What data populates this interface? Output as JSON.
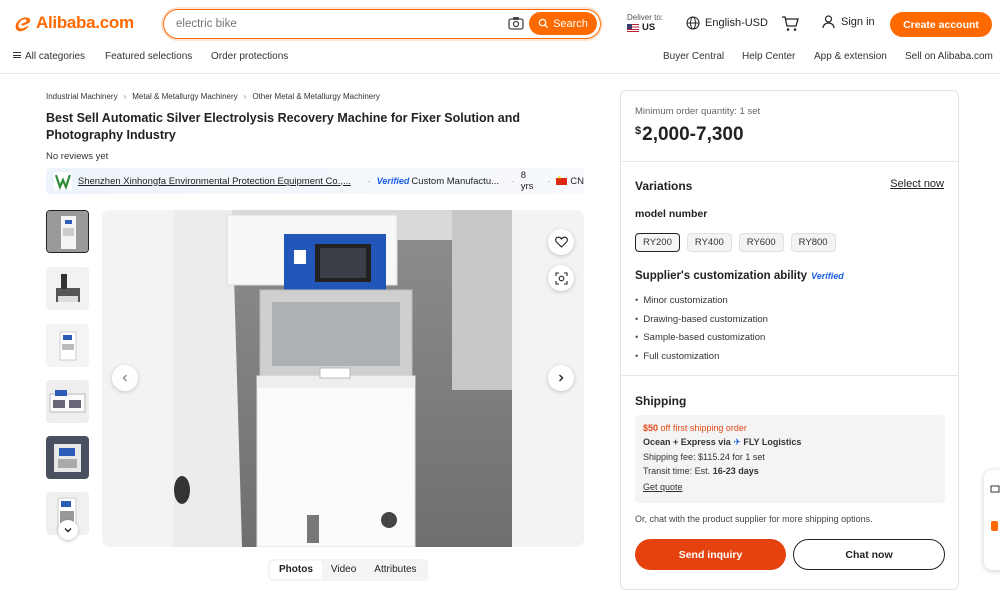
{
  "header": {
    "logo_text": "Alibaba.com",
    "search_placeholder": "electric bike",
    "search_button": "Search",
    "deliver_label": "Deliver to:",
    "deliver_country": "US",
    "language": "English-USD",
    "signin": "Sign in",
    "create_account": "Create account",
    "brand_color": "#ff6a00"
  },
  "nav": {
    "all_categories": "All categories",
    "featured": "Featured selections",
    "order_protections": "Order protections",
    "buyer_central": "Buyer Central",
    "help_center": "Help Center",
    "app_extension": "App & extension",
    "sell": "Sell on Alibaba.com"
  },
  "breadcrumb": [
    "Industrial Machinery",
    "Metal & Metallurgy Machinery",
    "Other Metal & Metallurgy Machinery"
  ],
  "product": {
    "title": "Best Sell Automatic Silver Electrolysis Recovery Machine for Fixer Solution and Photography Industry",
    "reviews": "No reviews yet"
  },
  "supplier": {
    "name": "Shenzhen Xinhongfa Environmental Protection Equipment Co.,...",
    "verified": "Verified",
    "type": "Custom Manufactu...",
    "years": "8 yrs",
    "country": "CN"
  },
  "media_tabs": [
    "Photos",
    "Video",
    "Attributes"
  ],
  "purchase": {
    "moq": "Minimum order quantity: 1 set",
    "price_symbol": "$",
    "price": "2,000-7,300",
    "variations_title": "Variations",
    "select_now": "Select now",
    "model_label": "model number",
    "models": [
      "RY200",
      "RY400",
      "RY600",
      "RY800"
    ],
    "customization_title": "Supplier's customization ability",
    "customization_badge": "Verified",
    "customization": [
      "Minor customization",
      "Drawing-based customization",
      "Sample-based customization",
      "Full customization"
    ],
    "shipping_title": "Shipping",
    "promo_amount": "$50",
    "promo_text": "off first shipping order",
    "ship_method": "Ocean + Express via",
    "ship_carrier": "FLY Logistics",
    "ship_fee": "Shipping fee: $115.24 for 1 set",
    "transit_prefix": "Transit time: Est.",
    "transit_days": "16-23 days",
    "get_quote": "Get quote",
    "chat_note": "Or, chat with the product supplier for more shipping options.",
    "send_inquiry": "Send inquiry",
    "chat_now": "Chat now"
  }
}
